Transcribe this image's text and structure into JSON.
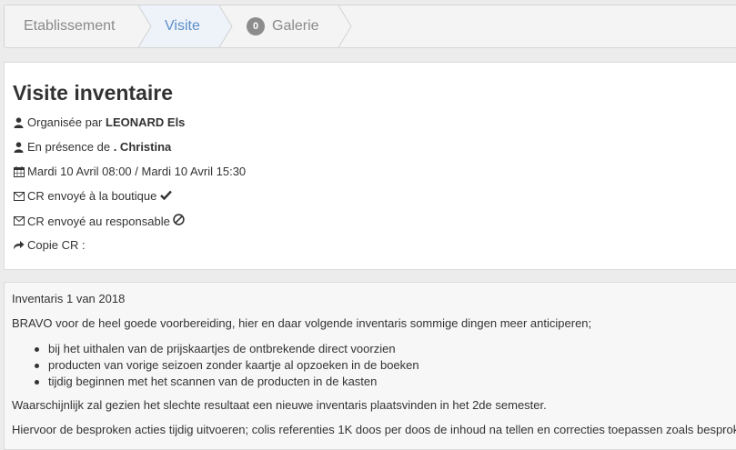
{
  "tabs": [
    {
      "label": "Etablissement"
    },
    {
      "label": "Visite"
    },
    {
      "label": "Galerie",
      "badge": "0"
    }
  ],
  "visit": {
    "title": "Visite inventaire",
    "organized_prefix": "Organisée par",
    "organizer": "LEONARD Els",
    "presence_prefix": "En présence de",
    "attendee": ". Christina",
    "dates": "Mardi 10 Avril 08:00 / Mardi 10 Avril 15:30",
    "cr_shop": "CR envoyé à la boutique",
    "cr_manager": "CR envoyé au responsable",
    "copy_cr": "Copie CR :"
  },
  "report": {
    "heading": "Inventaris 1 van 2018",
    "intro": "BRAVO voor de heel goede voorbereiding, hier en daar volgende inventaris sommige dingen meer anticiperen;",
    "items": [
      "bij het uithalen van de prijskaartjes de ontbrekende direct voorzien",
      "producten van vorige seizoen zonder kaartje al opzoeken in de boeken",
      "tijdig beginnen met het scannen van de producten in de kasten"
    ],
    "p2": "Waarschijnlijk zal gezien het slechte resultaat een nieuwe inventaris plaatsvinden in het 2de semester.",
    "p3": "Hiervoor de besproken acties tijdig uitvoeren; colis referenties 1K doos per doos de inhoud na tellen en correcties toepassen zoals besproken"
  },
  "colors": {
    "active_tab": "#5b8fc7",
    "tab_text": "#8a8a8a",
    "badge": "#8c8c8c"
  },
  "icons": [
    "user-icon",
    "calendar-icon",
    "envelope-icon",
    "check-icon",
    "ban-icon",
    "share-icon"
  ]
}
